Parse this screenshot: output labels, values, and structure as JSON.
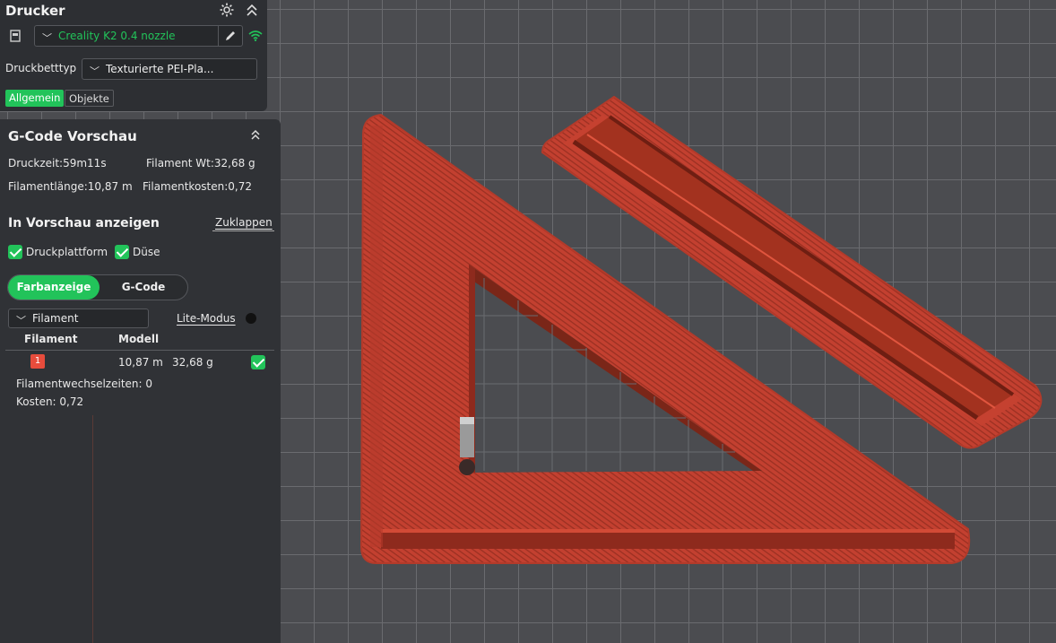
{
  "printer": {
    "title": "Drucker",
    "printer_name": "Creality K2 0.4 nozzle",
    "bed_label": "Druckbetttyp",
    "bed_value": "Texturierte PEI-Pla...",
    "tabs": [
      "Allgemein",
      "Objekte"
    ]
  },
  "gcode": {
    "title": "G-Code Vorschau",
    "print_time": "Druckzeit:59m11s",
    "filament_weight": "Filament Wt:32,68 g",
    "filament_length": "Filamentlänge:10,87 m",
    "filament_cost": "Filamentkosten:0,72",
    "preview_title": "In Vorschau anzeigen",
    "collapse_label": "Zuklappen",
    "checkbox_bed": "Druckplattform",
    "checkbox_nozzle": "Düse",
    "toggle_color": "Farbanzeige",
    "toggle_gcode": "G-Code",
    "filter_value": "Filament",
    "lite_mode": "Lite-Modus",
    "table_headers": [
      "Filament",
      "Modell"
    ],
    "row": {
      "index": "1",
      "length": "10,87 m",
      "weight": "32,68 g"
    },
    "changes": "Filamentwechselzeiten:  0",
    "cost": "Kosten:  0,72"
  },
  "colors": {
    "accent": "#22c35a",
    "filament": "#c8412f",
    "filament_dark": "#8e2a1d",
    "badge": "#e74c3c"
  },
  "icons": [
    "gear-icon",
    "collapse-up-icon",
    "printer-icon",
    "edit-icon",
    "wifi-icon",
    "checkbox-icon",
    "chevron-down-icon"
  ]
}
